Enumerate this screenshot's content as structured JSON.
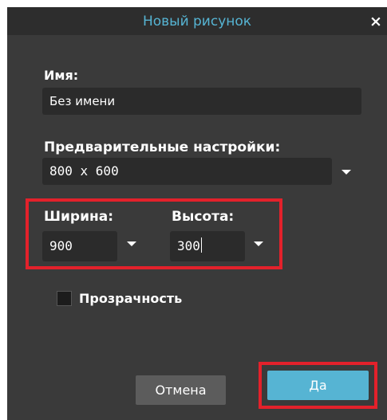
{
  "dialog": {
    "title": "Новый рисунок",
    "close_symbol": "×"
  },
  "name": {
    "label": "Имя:",
    "value": "Без имени"
  },
  "presets": {
    "label": "Предварительные настройки:",
    "value": "800 x 600"
  },
  "width": {
    "label": "Ширина:",
    "value": "900"
  },
  "height": {
    "label": "Высота:",
    "value": "300"
  },
  "transparency": {
    "label": "Прозрачность",
    "checked": false
  },
  "buttons": {
    "cancel_label": "Отмена",
    "ok_label": "Да"
  },
  "colors": {
    "dialog_bg": "#3a3a3a",
    "titlebar_bg": "#2d2d2d",
    "title_color": "#56b4d3",
    "field_bg": "#2b2b2b",
    "cancel_bg": "#5c5c5c",
    "ok_bg": "#56b4d3",
    "highlight": "#e3212b"
  }
}
